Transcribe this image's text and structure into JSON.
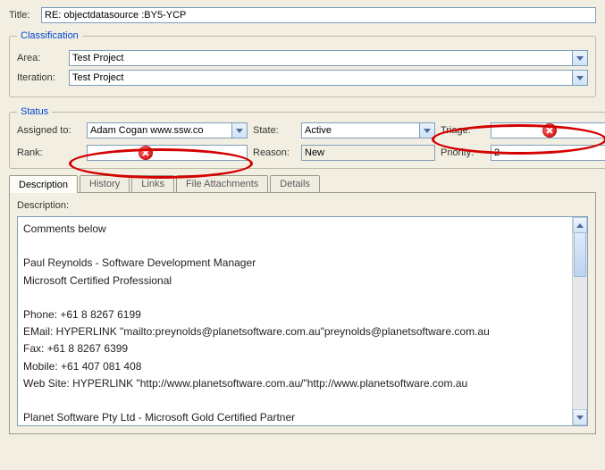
{
  "title": {
    "label": "Title:",
    "value": "RE: objectdatasource :BY5-YCP"
  },
  "classification": {
    "legend": "Classification",
    "area": {
      "label": "Area:",
      "value": "Test Project"
    },
    "iteration": {
      "label": "Iteration:",
      "value": "Test Project"
    }
  },
  "status": {
    "legend": "Status",
    "assigned": {
      "label": "Assigned to:",
      "value": "Adam Cogan www.ssw.co"
    },
    "state": {
      "label": "State:",
      "value": "Active"
    },
    "triage": {
      "label": "Triage:",
      "value": ""
    },
    "rank": {
      "label": "Rank:",
      "value": ""
    },
    "reason": {
      "label": "Reason:",
      "value": "New"
    },
    "priority": {
      "label": "Priority:",
      "value": "2"
    }
  },
  "tabs": {
    "description": "Description",
    "history": "History",
    "links": "Links",
    "attachments": "File Attachments",
    "details": "Details"
  },
  "description": {
    "label": "Description:",
    "content": "Comments below\n\nPaul Reynolds - Software Development Manager\nMicrosoft Certified Professional\n\nPhone: +61 8 8267 6199\nEMail: HYPERLINK \"mailto:preynolds@planetsoftware.com.au\"preynolds@planetsoftware.com.au\nFax: +61 8 8267 6399\nMobile: +61 407 081 408\nWeb Site: HYPERLINK \"http://www.planetsoftware.com.au/\"http://www.planetsoftware.com.au\n\nPlanet Software Pty Ltd - Microsoft Gold Certified Partner"
  },
  "annotations": {
    "rank_error": true,
    "triage_error": true
  }
}
